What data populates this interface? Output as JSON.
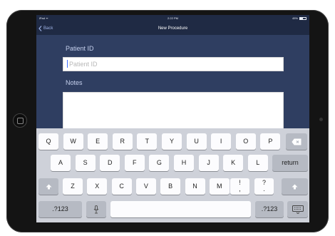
{
  "status": {
    "carrier": "iPad ᯤ",
    "time": "2:22 PM",
    "battery_text": "45%",
    "battery_level": 0.45
  },
  "nav": {
    "back_label": "Back",
    "title": "New Procedure"
  },
  "form": {
    "patient_id_label": "Patient ID",
    "patient_id_placeholder": "Patient ID",
    "notes_label": "Notes"
  },
  "keyboard": {
    "row1": [
      "Q",
      "W",
      "E",
      "R",
      "T",
      "Y",
      "U",
      "I",
      "O",
      "P"
    ],
    "row2": [
      "A",
      "S",
      "D",
      "F",
      "G",
      "H",
      "J",
      "K",
      "L"
    ],
    "row3": [
      "Z",
      "X",
      "C",
      "V",
      "B",
      "N",
      "M"
    ],
    "exclam": "!\n,",
    "question": "?\n.",
    "return_label": "return",
    "numbers_label": ".?123",
    "numbers_label_right": ".?123"
  },
  "colors": {
    "nav_bg": "#1f2a44",
    "content_bg": "#2f3e61",
    "keyboard_bg": "#ced1d9",
    "label_color": "#c6d1ee"
  }
}
